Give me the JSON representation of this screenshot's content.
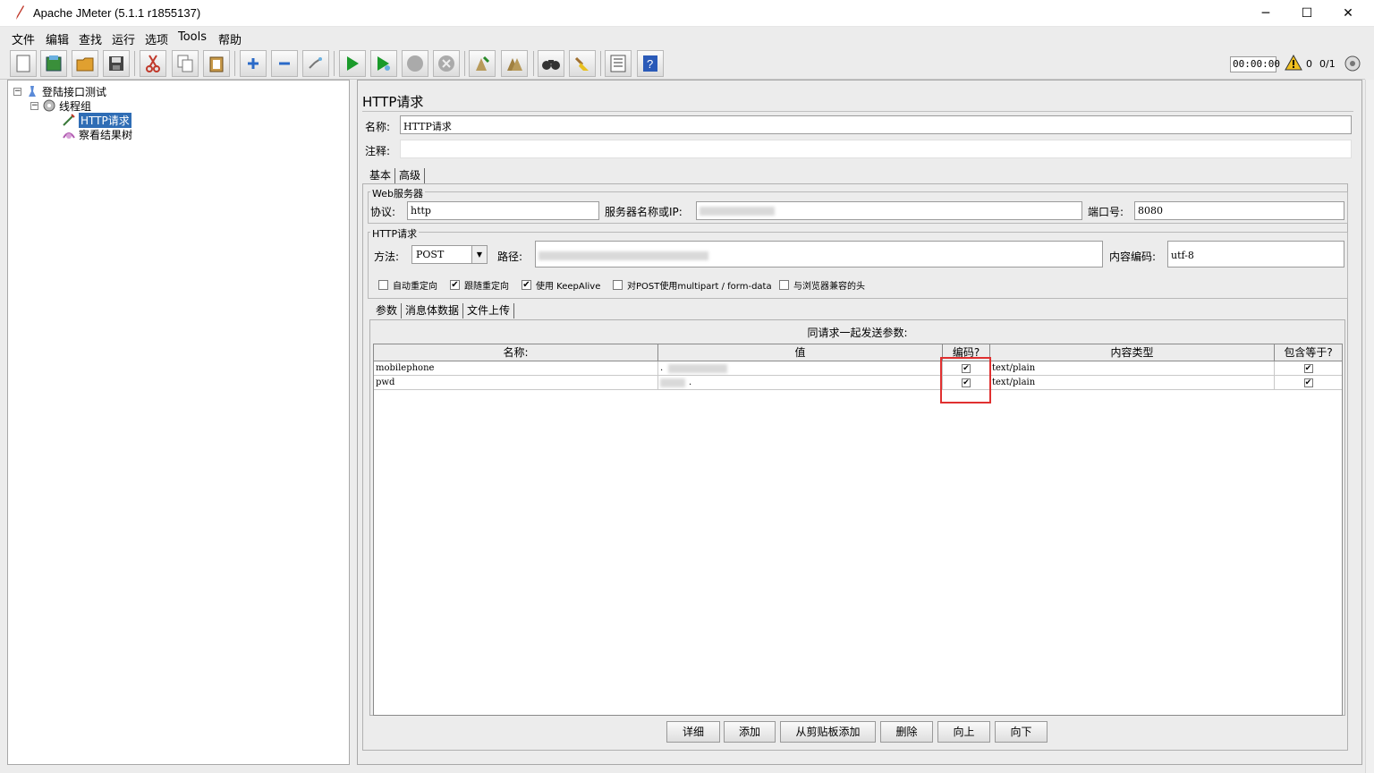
{
  "window": {
    "title": "Apache JMeter (5.1.1 r1855137)",
    "min": "─",
    "max": "☐",
    "close": "✕"
  },
  "menu": [
    "文件",
    "编辑",
    "查找",
    "运行",
    "选项",
    "Tools",
    "帮助"
  ],
  "toolbar": {
    "icons": [
      "new-icon",
      "templates-icon",
      "open-icon",
      "save-icon",
      "cut-icon",
      "copy-icon",
      "paste-icon",
      "expand-icon",
      "collapse-icon",
      "toggle-icon",
      "start-icon",
      "start-no-pause-icon",
      "stop-icon",
      "shutdown-icon",
      "clear-icon",
      "clear-all-icon",
      "search-icon",
      "reset-search-icon",
      "function-helper-icon",
      "help-icon"
    ],
    "timer": "00:00:00",
    "warnings": "0",
    "threads": "0/1"
  },
  "tree": [
    {
      "label": "登陆接口测试",
      "icon": "test-plan-icon"
    },
    {
      "label": "线程组",
      "icon": "thread-group-icon"
    },
    {
      "label": "HTTP请求",
      "icon": "http-sampler-icon",
      "selected": true
    },
    {
      "label": "察看结果树",
      "icon": "results-tree-icon"
    }
  ],
  "panel": {
    "title": "HTTP请求",
    "name_label": "名称:",
    "name_value": "HTTP请求",
    "comment_label": "注释:",
    "tabs": [
      "基本",
      "高级"
    ],
    "web_server": {
      "group_title": "Web服务器",
      "protocol_label": "协议:",
      "protocol_value": "http",
      "server_label": "服务器名称或IP:",
      "port_label": "端口号:",
      "port_value": "8080"
    },
    "http_request": {
      "group_title": "HTTP请求",
      "method_label": "方法:",
      "method_value": "POST",
      "path_label": "路径:",
      "encoding_label": "内容编码:",
      "encoding_value": "utf-8"
    },
    "options": [
      {
        "label": "自动重定向",
        "checked": false
      },
      {
        "label": "跟随重定向",
        "checked": true
      },
      {
        "label": "使用 KeepAlive",
        "checked": true
      },
      {
        "label": "对POST使用multipart / form-data",
        "checked": false
      },
      {
        "label": "与浏览器兼容的头",
        "checked": false
      }
    ],
    "sub_tabs": [
      "参数",
      "消息体数据",
      "文件上传"
    ],
    "params_caption": "同请求一起发送参数:",
    "columns": [
      "名称:",
      "值",
      "编码?",
      "内容类型",
      "包含等于?"
    ],
    "rows": [
      {
        "name": "mobilephone",
        "value": ".",
        "encode": true,
        "content_type": "text/plain",
        "include_equals": true
      },
      {
        "name": "pwd",
        "value": ".",
        "encode": true,
        "content_type": "text/plain",
        "include_equals": true
      }
    ],
    "buttons": [
      "详细",
      "添加",
      "从剪贴板添加",
      "删除",
      "向上",
      "向下"
    ]
  }
}
